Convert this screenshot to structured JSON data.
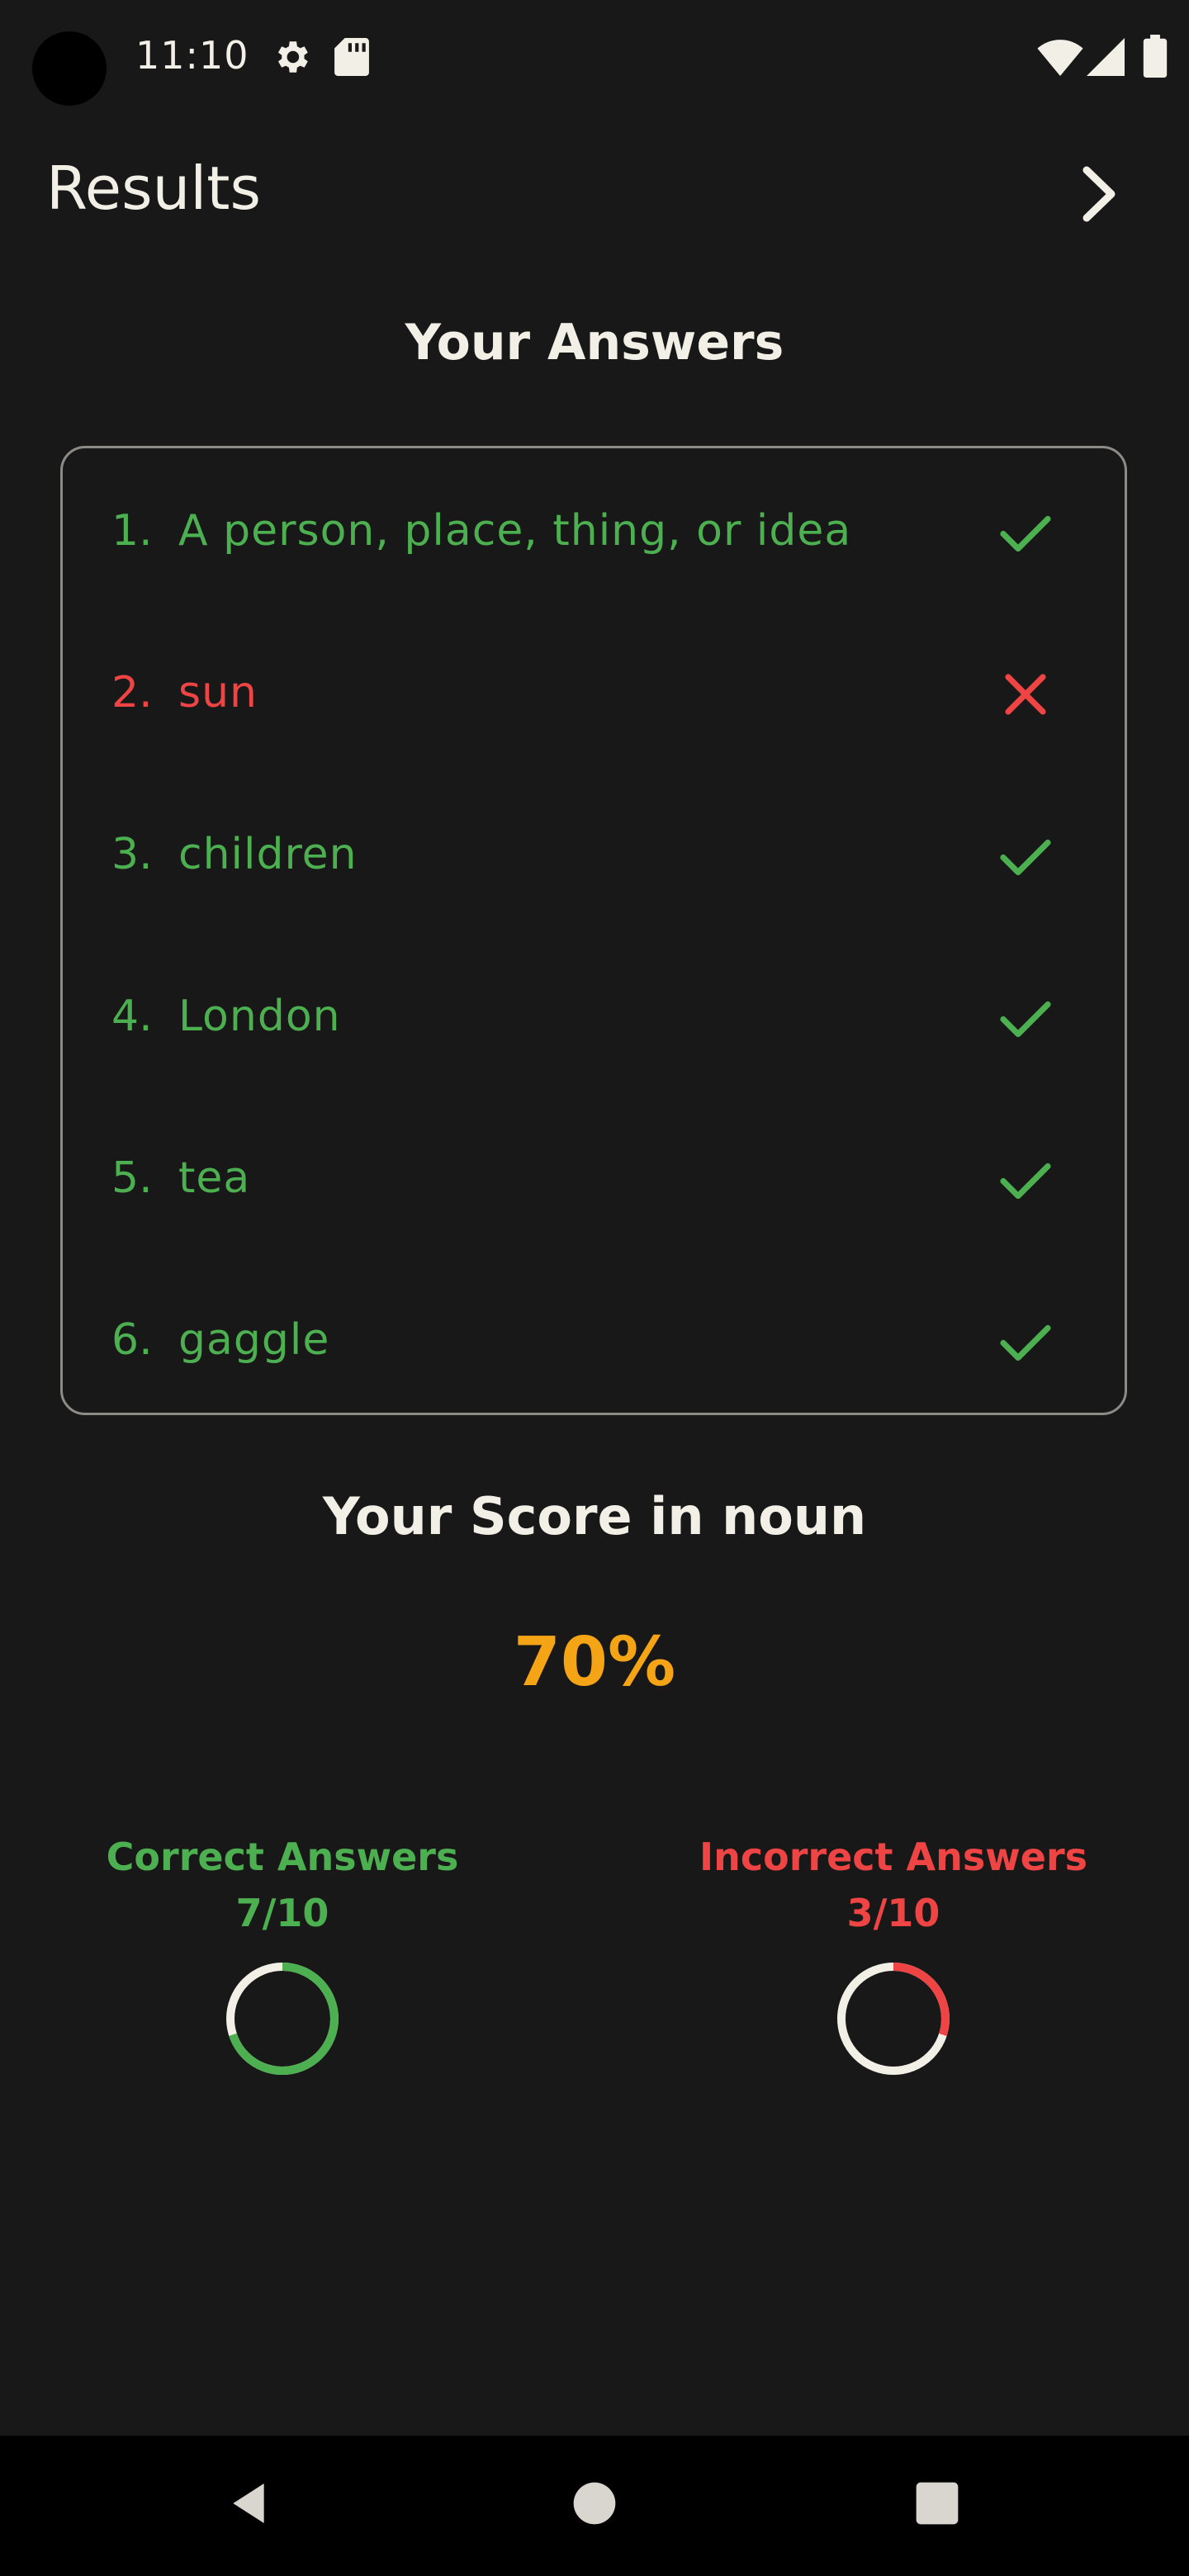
{
  "status_bar": {
    "time": "11:10",
    "icons": [
      "settings-icon",
      "sd-card-icon",
      "wifi-icon",
      "signal-icon",
      "battery-icon"
    ]
  },
  "app_bar": {
    "title": "Results",
    "next_icon": "chevron-right-icon"
  },
  "answers": {
    "heading": "Your Answers",
    "items": [
      {
        "number": "1.",
        "text": "A person, place, thing, or idea",
        "correct": true
      },
      {
        "number": "2.",
        "text": "sun",
        "correct": false
      },
      {
        "number": "3.",
        "text": "children",
        "correct": true
      },
      {
        "number": "4.",
        "text": "London",
        "correct": true
      },
      {
        "number": "5.",
        "text": "tea",
        "correct": true
      },
      {
        "number": "6.",
        "text": "gaggle",
        "correct": true
      }
    ]
  },
  "score": {
    "heading": "Your Score in noun",
    "value": "70%"
  },
  "stats": {
    "correct": {
      "label": "Correct Answers",
      "count": "7/10",
      "fraction": 0.7
    },
    "incorrect": {
      "label": "Incorrect Answers",
      "count": "3/10",
      "fraction": 0.3
    }
  },
  "colors": {
    "background": "#191819",
    "correct": "#4caf50",
    "incorrect": "#ef4444",
    "score": "#f5a416",
    "text": "#f2efe6",
    "ring_track": "#f2efe6"
  },
  "nav_bar": {
    "icons": [
      "back-icon",
      "home-icon",
      "recents-icon"
    ]
  }
}
